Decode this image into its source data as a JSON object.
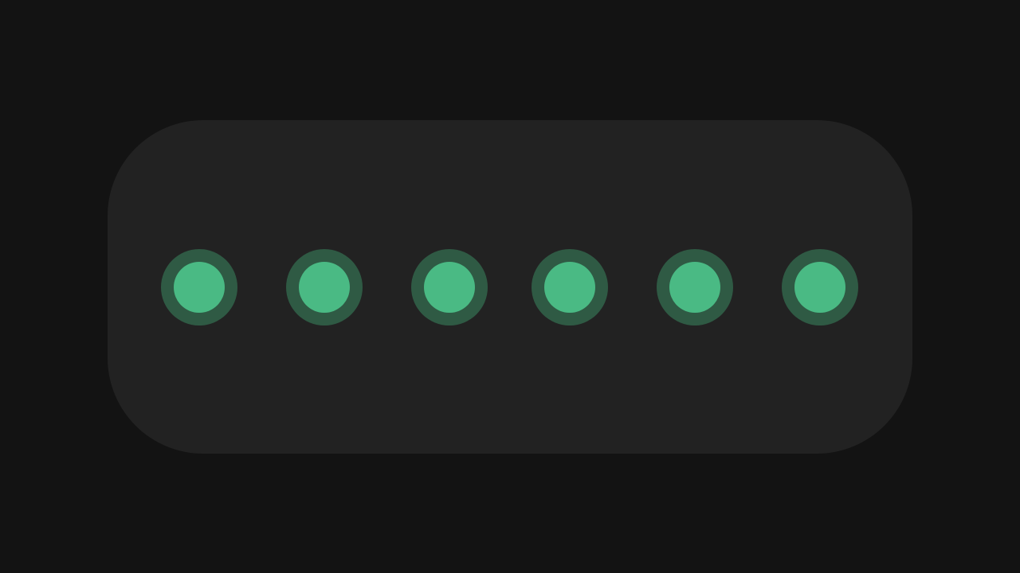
{
  "colors": {
    "background": "#131313",
    "panel": "#222222",
    "dot_fill": "#4aba84",
    "dot_ring": "#2f5a44"
  },
  "indicators": [
    {
      "state": "active"
    },
    {
      "state": "active"
    },
    {
      "state": "active"
    },
    {
      "state": "active"
    },
    {
      "state": "active"
    },
    {
      "state": "active"
    }
  ]
}
